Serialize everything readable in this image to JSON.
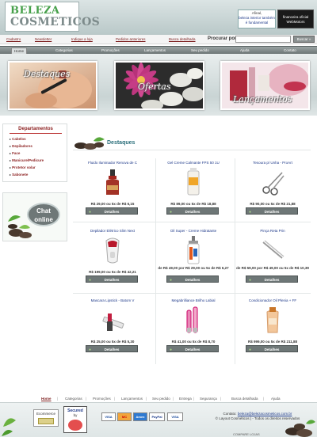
{
  "header": {
    "logo_line1": "BELEZA",
    "logo_line2": "COSMETICOS",
    "promo1_pre": "Afinal,",
    "promo1_text": "beleza interior também é fundamental",
    "promo2_text": "financeira oficial WebMotors"
  },
  "topnav": {
    "links": [
      "Cadastro",
      "Newsletter",
      "Indique a loja",
      "Pedidos anteriores",
      "Busca detalhada"
    ],
    "search_label": "Procurar por:",
    "search_button": "Buscar »"
  },
  "mainnav": {
    "items": [
      "Home",
      "Categorias",
      "Promoções",
      "Lançamentos",
      "Seu pedido",
      "Ajuda",
      "Contato"
    ]
  },
  "banners": {
    "destaques": "Destaques",
    "ofertas": "Ofertas",
    "lancamentos": "Lançamentos"
  },
  "sidebar": {
    "title": "Departamentos",
    "items": [
      "Cabelos",
      "Depiladores",
      "Face",
      "Manicure/Pedicure",
      "Protetor solar",
      "Sabonete"
    ],
    "chat_line1": "Chat",
    "chat_line2": "online"
  },
  "section": {
    "title": "Destaques"
  },
  "products": [
    {
      "name": "Fluido Iluminador Renova de C",
      "price": "R$ 29,00 ou 5x de R$ 6,15",
      "button": "Detalhes"
    },
    {
      "name": "Gel Creme Calmante FPS 50 1U",
      "price": "R$ 89,00 ou 5x de R$ 18,88",
      "button": "Detalhes"
    },
    {
      "name": "Tesoura p/ Unha - ProArt",
      "price": "R$ 90,00 ou 5x de R$ 21,88",
      "button": "Detalhes"
    },
    {
      "name": "Depilador Elétrico Slim Next",
      "price": "R$ 199,00 ou 5x de R$ 42,21",
      "button": "Detalhes"
    },
    {
      "name": "Oil Super - Creme Hidratante",
      "price": "de R$ 49,00 por R$ 29,00 ou 5x de R$ 6,27",
      "button": "Detalhes"
    },
    {
      "name": "Pinça Reta Prin",
      "price": "de R$ 59,00 por R$ 49,00 ou 5x de R$ 10,39",
      "button": "Detalhes"
    },
    {
      "name": "Mascara Lipstick - Batom V",
      "price": "R$ 25,00 ou 5x de R$ 5,30",
      "button": "Detalhes"
    },
    {
      "name": "Megabrilliance Brilho Labial",
      "price": "R$ 41,00 ou 5x de R$ 8,70",
      "button": "Detalhes"
    },
    {
      "name": "Condicionador Oil Plenia + FF",
      "price": "R$ 999,00 ou 5x de R$ 211,88",
      "button": "Detalhes"
    }
  ],
  "footer": {
    "links": [
      "Home",
      "Categorias",
      "Promoções",
      "Lançamentos",
      "Seu pedido",
      "Entrega",
      "Segurança",
      "Busca detalhada",
      "Ajuda"
    ],
    "seal1": "Ecommerce",
    "seal2_line1": "Secured",
    "seal2_line2": "by",
    "payments": [
      "VISA",
      "MC",
      "Amex",
      "PayPal",
      "VISA"
    ],
    "contact_label": "Contato:",
    "contact_email": "beleza@belezacosmeticos.com.br",
    "copyright": "© Layout Cosméticos | - Todos os direitos reservados",
    "compare": "COMPARE LOJAS"
  }
}
